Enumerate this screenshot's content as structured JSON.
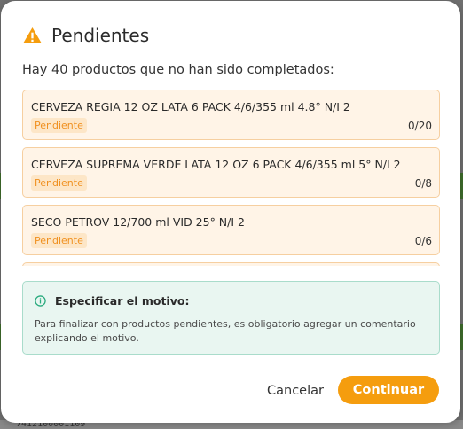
{
  "dialog": {
    "title": "Pendientes",
    "subtitle": "Hay 40 productos que no han sido completados:",
    "products": [
      {
        "name": "CERVEZA REGIA 12 OZ LATA 6 PACK 4/6/355 ml 4.8° N/I 2",
        "status": "Pendiente",
        "count": "0/20"
      },
      {
        "name": "CERVEZA SUPREMA VERDE LATA 12 OZ 6 PACK 4/6/355 ml 5° N/I 2",
        "status": "Pendiente",
        "count": "0/8"
      },
      {
        "name": "SECO PETROV 12/700 ml VID 25° N/I 2",
        "status": "Pendiente",
        "count": "0/6"
      }
    ],
    "info": {
      "title": "Especificar el motivo:",
      "text": "Para finalizar con productos pendientes, es obligatorio agregar un comentario explicando el motivo."
    },
    "buttons": {
      "cancel": "Cancelar",
      "continue": "Continuar"
    }
  },
  "background": {
    "bottom_text": "7412100001109"
  },
  "colors": {
    "accent": "#f59d0e",
    "warning": "#f0901f",
    "info_border": "#a9dccb",
    "info_bg": "#e9f6f1",
    "card_bg": "#fff4e7"
  }
}
